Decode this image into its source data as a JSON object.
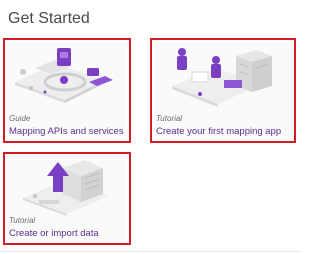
{
  "page": {
    "title": "Get Started"
  },
  "cards": [
    {
      "kind": "Guide",
      "name": "Mapping APIs and services",
      "image": "isometric-map-services-illustration"
    },
    {
      "kind": "Tutorial",
      "name": "Create your first mapping app",
      "image": "isometric-app-building-illustration"
    },
    {
      "kind": "Tutorial",
      "name": "Create or import data",
      "image": "isometric-data-upload-illustration"
    }
  ],
  "colors": {
    "highlight_border": "#d01c24",
    "link": "#5c2f8f",
    "accent": "#7b3fc4",
    "title": "#4a4a4a"
  }
}
